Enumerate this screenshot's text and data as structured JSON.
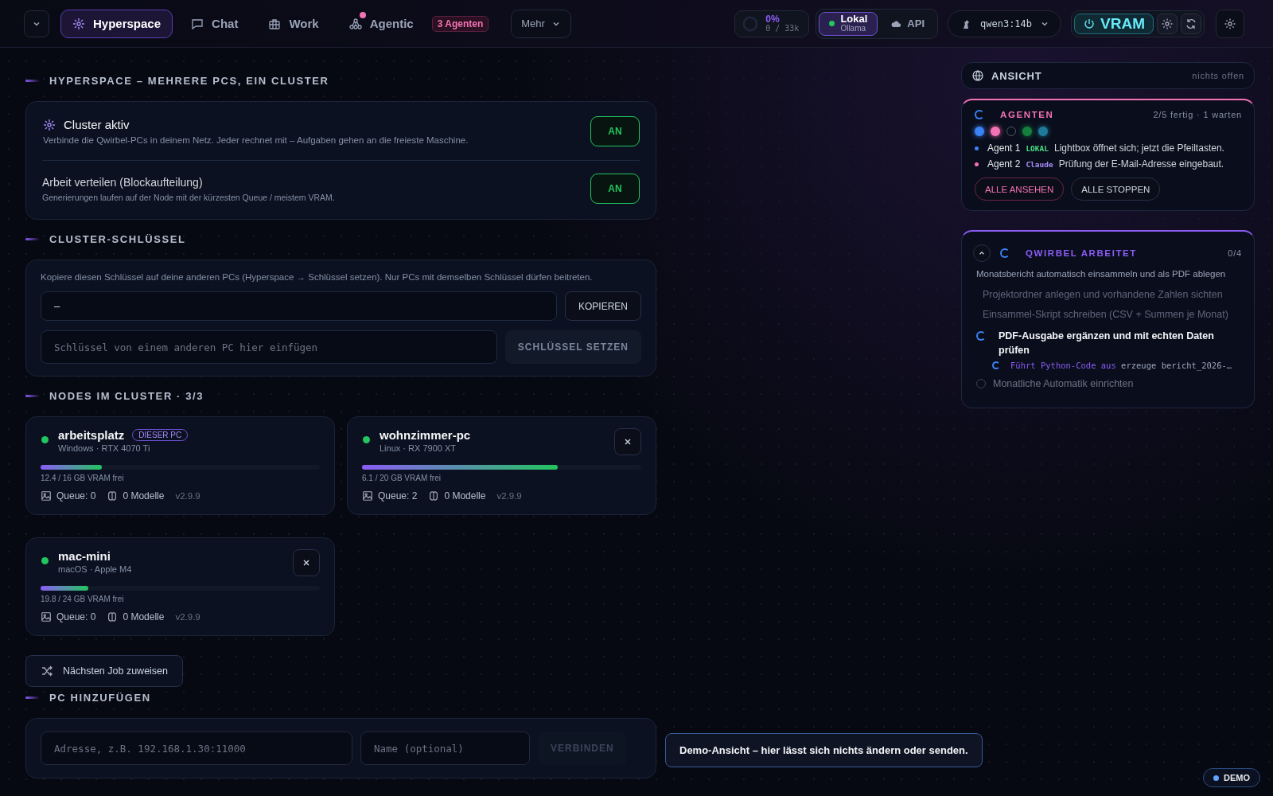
{
  "nav": {
    "tabs": [
      {
        "label": "Hyperspace",
        "selected": true,
        "notify": false
      },
      {
        "label": "Chat",
        "selected": false,
        "notify": false
      },
      {
        "label": "Work",
        "selected": false,
        "notify": false
      },
      {
        "label": "Agentic",
        "selected": false,
        "notify": true,
        "badge": "3 Agenten"
      }
    ],
    "more": "Mehr",
    "context": {
      "percent": "0%",
      "tokens": "0 / 33k",
      "level": 0
    },
    "modes": [
      {
        "label": "Lokal",
        "sub": "Ollama",
        "selected": true
      },
      {
        "label": "API",
        "selected": false
      }
    ],
    "model": "qwen3:14b",
    "vram": "VRAM"
  },
  "sections": [
    {
      "kind": "toggles",
      "title": "HYPERSPACE – MEHRERE PCS, EIN CLUSTER",
      "toggles": [
        {
          "title": "Cluster aktiv",
          "desc": "Verbinde die Qwirbel-PCs in deinem Netz. Jeder rechnet mit – Aufgaben gehen an die freieste Maschine.",
          "on": true,
          "state": "AN"
        },
        {
          "title": "Arbeit verteilen (Blockaufteilung)",
          "desc": "Generierungen laufen auf der Node mit der kürzesten Queue / meistem VRAM.",
          "on": true,
          "state": "AN"
        }
      ]
    },
    {
      "kind": "key",
      "title": "CLUSTER-SCHLÜSSEL",
      "hint": "Kopiere diesen Schlüssel auf deine anderen PCs (Hyperspace → Schlüssel setzen). Nur PCs mit demselben Schlüssel dürfen beitreten.",
      "key": "–",
      "copy": "KOPIEREN",
      "placeholder": "Schlüssel von einem anderen PC hier einfügen",
      "set": "SCHLÜSSEL SETZEN"
    },
    {
      "kind": "nodes",
      "title": "NODES IM CLUSTER · 3/3",
      "nodes": [
        {
          "name": "arbeitsplatz",
          "badge": "DIESER PC",
          "spec": "Windows · RTX 4070 Ti",
          "level": 0.22,
          "vram": "12.4 / 16 GB VRAM frei",
          "queue": "Queue: 0",
          "models": "0 Modelle",
          "version": "v2.9.9",
          "online": true,
          "removable": false
        },
        {
          "name": "wohnzimmer-pc",
          "spec": "Linux · RX 7900 XT",
          "level": 0.7,
          "vram": "6.1 / 20 GB VRAM frei",
          "queue": "Queue: 2",
          "models": "0 Modelle",
          "version": "v2.9.9",
          "online": true,
          "removable": true
        },
        {
          "name": "mac-mini",
          "spec": "macOS · Apple M4",
          "level": 0.17,
          "vram": "19.8 / 24 GB VRAM frei",
          "queue": "Queue: 0",
          "models": "0 Modelle",
          "version": "v2.9.9",
          "online": true,
          "removable": true
        }
      ],
      "action": "Nächsten Job zuweisen"
    },
    {
      "kind": "add",
      "title": "PC HINZUFÜGEN",
      "address_placeholder": "Adresse, z.B. 192.168.1.30:11000",
      "name_placeholder": "Name (optional)",
      "connect": "VERBINDEN"
    }
  ],
  "view": {
    "title": "ANSICHT",
    "status": "nichts offen"
  },
  "agents": {
    "title": "AGENTEN",
    "status": "2/5 fertig · 1 warten",
    "dots": [
      {
        "kind": "filled",
        "color": "#3b82f6"
      },
      {
        "kind": "filled",
        "color": "#f472b6"
      },
      {
        "kind": "empty"
      },
      {
        "kind": "filled",
        "color": "#15803d"
      },
      {
        "kind": "filled",
        "color": "#1f7a99"
      }
    ],
    "lines": [
      {
        "name": "Agent 1",
        "tag": "LOKAL",
        "kind": "local",
        "text": "Lightbox öffnet sich; jetzt die Pfeiltasten.",
        "color": "#3b82f6"
      },
      {
        "name": "Agent 2",
        "tag": "Claude",
        "kind": "api",
        "text": "Prüfung der E-Mail-Adresse eingebaut.",
        "color": "#f472b6"
      }
    ],
    "view_all": "ALLE ANSEHEN",
    "stop_all": "ALLE STOPPEN"
  },
  "work": {
    "title": "QWIRBEL ARBEITET",
    "count": "0/4",
    "expanded": true,
    "goal": "Monatsbericht automatisch einsammeln und als PDF ablegen",
    "steps": [
      {
        "kind": "done",
        "text": "Projektordner anlegen und vorhandene Zahlen sichten"
      },
      {
        "kind": "done",
        "text": "Einsammel-Skript schreiben (CSV + Summen je Monat)"
      },
      {
        "kind": "active",
        "text": "PDF-Ausgabe ergänzen und mit echten Daten prüfen",
        "detail": {
          "action": "Führt Python-Code aus",
          "arg": "erzeuge bericht_2026-…"
        }
      },
      {
        "kind": "pending",
        "text": "Monatliche Automatik einrichten"
      }
    ]
  },
  "toast": "Demo-Ansicht – hier lässt sich nichts ändern oder senden.",
  "demo": "DEMO"
}
